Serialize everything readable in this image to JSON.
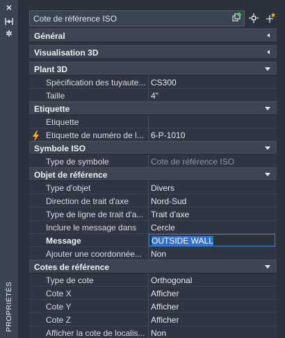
{
  "palette": {
    "panel_bg": "#2f3542",
    "section_bg": "#3d4553",
    "strip_bg": "#3b4453",
    "highlight": "#3470c4",
    "accent_yellow": "#f3b21c"
  },
  "strip": {
    "title": "PROPRIÉTÉS",
    "icons": [
      "close-icon",
      "auto-hide-icon",
      "settings-icon"
    ]
  },
  "header": {
    "selected_object": "Cote de référence ISO",
    "toolbar": [
      "toggle-pickadd-icon",
      "select-objects-icon",
      "quick-select-icon"
    ]
  },
  "sections": {
    "general": "Général",
    "view3d": "Visualisation 3D",
    "plant3d": {
      "title": "Plant 3D",
      "rows": [
        {
          "label": "Spécification des tuyaute...",
          "value": "CS300"
        },
        {
          "label": "Taille",
          "value": "4\""
        }
      ]
    },
    "etiquette": {
      "title": "Etiquette",
      "rows": [
        {
          "label": "Etiquette",
          "value": ""
        },
        {
          "label": "Etiquette de numéro de l...",
          "value": "6-P-1010"
        }
      ]
    },
    "symbole": {
      "title": "Symbole ISO",
      "rows": [
        {
          "label": "Type de symbole",
          "value": "Cote de référence ISO"
        }
      ]
    },
    "objet": {
      "title": "Objet de référence",
      "rows": [
        {
          "label": "Type d'objet",
          "value": "Divers"
        },
        {
          "label": "Direction de trait d'axe",
          "value": "Nord-Sud"
        },
        {
          "label": "Type de ligne de trait d'a...",
          "value": "Trait d'axe"
        },
        {
          "label": "Inclure le message dans",
          "value": "Cercle"
        },
        {
          "label": "Message",
          "value": "OUTSIDE WALL"
        },
        {
          "label": "Ajouter une coordonnée...",
          "value": "Non"
        }
      ]
    },
    "cotes": {
      "title": "Cotes de référence",
      "rows": [
        {
          "label": "Type de cote",
          "value": "Orthogonal"
        },
        {
          "label": "Cote X",
          "value": "Afficher"
        },
        {
          "label": "Cote Y",
          "value": "Afficher"
        },
        {
          "label": "Cote Z",
          "value": "Afficher"
        },
        {
          "label": "Afficher la cote de localis...",
          "value": "Non"
        }
      ]
    }
  }
}
